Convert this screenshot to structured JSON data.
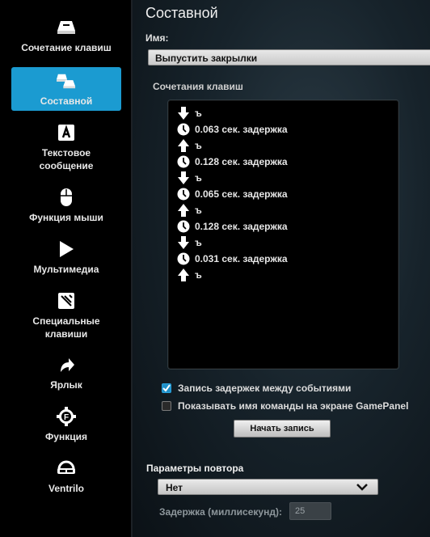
{
  "sidebar": {
    "items": [
      {
        "label": "Сочетание клавиш",
        "icon": "key-combo-icon"
      },
      {
        "label": "Составной",
        "icon": "multi-key-icon",
        "active": true
      },
      {
        "label": "Текстовое\nсообщение",
        "icon": "text-a-icon"
      },
      {
        "label": "Функция мыши",
        "icon": "mouse-icon"
      },
      {
        "label": "Мультимедиа",
        "icon": "play-icon"
      },
      {
        "label": "Специальные\nклавиши",
        "icon": "special-keys-icon"
      },
      {
        "label": "Ярлык",
        "icon": "shortcut-arrow-icon"
      },
      {
        "label": "Функция",
        "icon": "function-f-icon"
      },
      {
        "label": "Ventrilo",
        "icon": "headset-icon"
      }
    ]
  },
  "main": {
    "title": "Составной",
    "name_label": "Имя:",
    "name_value": "Выпустить закрылки",
    "sequence_label": "Сочетания клавиш",
    "sequence": [
      {
        "type": "down",
        "text": "ъ"
      },
      {
        "type": "delay",
        "text": "0.063 сек. задержка"
      },
      {
        "type": "up",
        "text": "ъ"
      },
      {
        "type": "delay",
        "text": "0.128 сек. задержка"
      },
      {
        "type": "down",
        "text": "ъ"
      },
      {
        "type": "delay",
        "text": "0.065 сек. задержка"
      },
      {
        "type": "up",
        "text": "ъ"
      },
      {
        "type": "delay",
        "text": "0.128 сек. задержка"
      },
      {
        "type": "down",
        "text": "ъ"
      },
      {
        "type": "delay",
        "text": "0.031 сек. задержка"
      },
      {
        "type": "up",
        "text": "ъ"
      }
    ],
    "record_delays": {
      "label": "Запись задержек между событиями",
      "checked": true
    },
    "show_name": {
      "label": "Показывать имя команды на экране GamePanel",
      "checked": false
    },
    "record_button": "Начать запись",
    "repeat_title": "Параметры повтора",
    "repeat_value": "Нет",
    "delay_label": "Задержка (миллисекунд):",
    "delay_value": "25"
  },
  "colors": {
    "accent": "#1b9bd1",
    "sidebar_bg": "#000000"
  }
}
